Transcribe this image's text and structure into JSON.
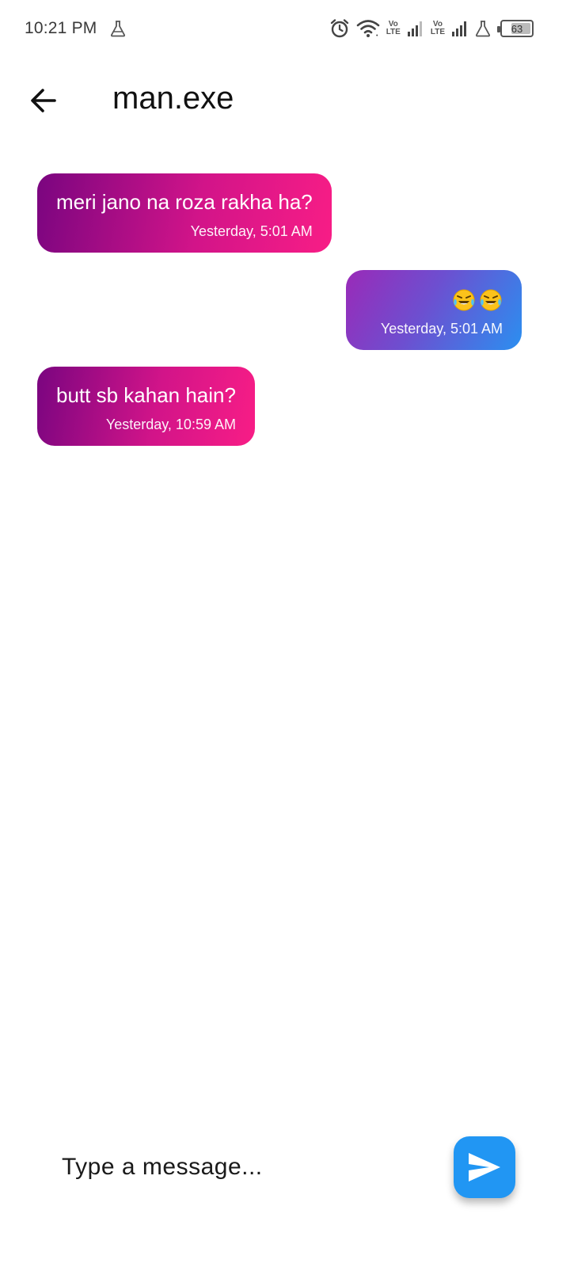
{
  "status_bar": {
    "time": "10:21 PM",
    "icons": [
      "flask-icon",
      "alarm-icon",
      "wifi-icon",
      "volte-icon",
      "signal-icon",
      "volte-icon",
      "signal-icon",
      "flask-icon",
      "battery-icon"
    ],
    "volte_top": "Vo",
    "volte_bottom": "LTE",
    "battery_level": "63",
    "battery_fraction": 0.63
  },
  "app_bar": {
    "back_icon": "arrow-left-icon",
    "title": "man.exe"
  },
  "messages": [
    {
      "direction": "received",
      "text": "meri jano na roza rakha ha?",
      "time": "Yesterday, 5:01 AM"
    },
    {
      "direction": "sent",
      "text": "🤣🤣",
      "emoji": "rolling-on-floor-laughing",
      "emoji_count": 2,
      "time": "Yesterday, 5:01 AM"
    },
    {
      "direction": "received",
      "text": "butt sb kahan hain?",
      "time": "Yesterday, 10:59 AM"
    }
  ],
  "composer": {
    "placeholder": "Type a message...",
    "value": "",
    "send_icon": "send-icon"
  },
  "colors": {
    "received_gradient": [
      "#7a0580",
      "#f81d86"
    ],
    "sent_gradient": [
      "#9a2ab8",
      "#2b8ff0"
    ],
    "send_button": "#2196f3",
    "background": "#ffffff"
  }
}
